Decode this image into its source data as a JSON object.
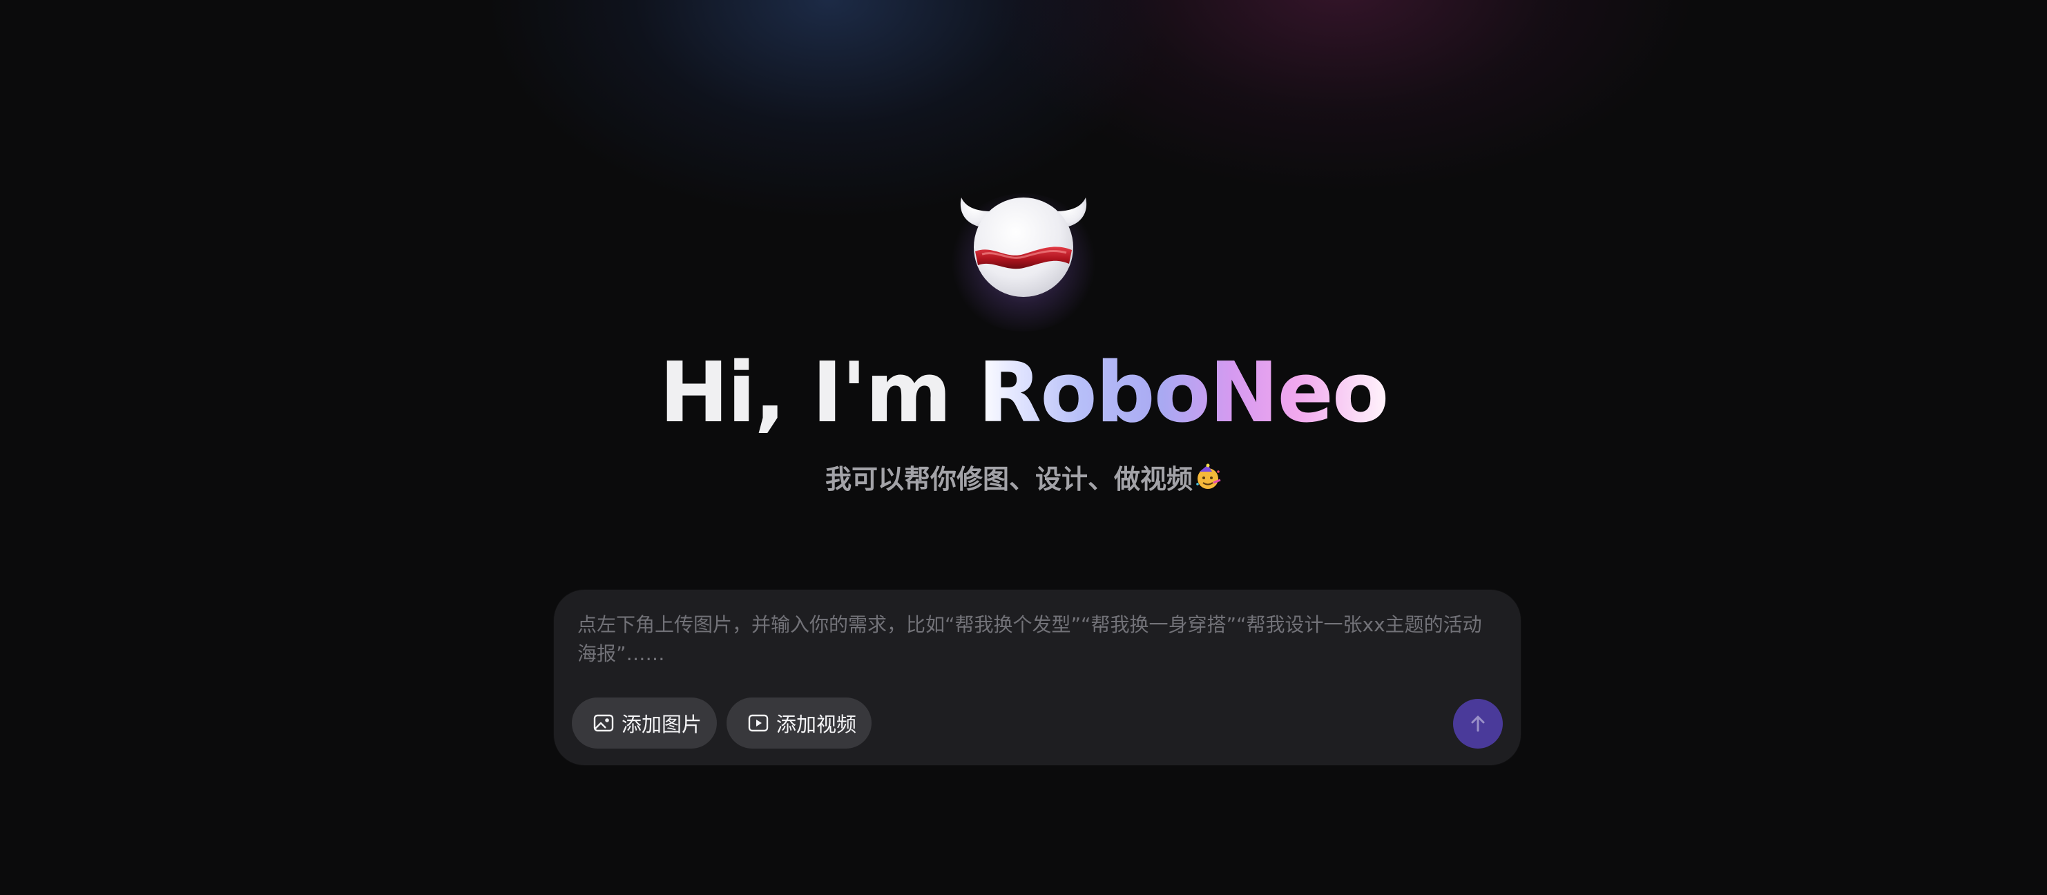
{
  "hero": {
    "greeting": "Hi, I'm ",
    "brand": "RoboNeo",
    "subtitle": "我可以帮你修图、设计、做视频",
    "subtitle_emoji": "🥳"
  },
  "composer": {
    "placeholder": "点左下角上传图片，并输入你的需求，比如“帮我换个发型”“帮我换一身穿搭”“帮我设计一张xx主题的活动海报”……",
    "value": "",
    "add_image_label": "添加图片",
    "add_image_icon": "image-icon",
    "add_video_label": "添加视频",
    "add_video_icon": "video-icon",
    "send_icon": "arrow-up-icon"
  },
  "colors": {
    "background": "#0b0b0c",
    "composer_bg": "#1e1e21",
    "pill_bg": "#38383c",
    "send_button": "#4a3a9a",
    "brand_gradient": [
      "#ffffff",
      "#a9a9f2",
      "#f1a8ee"
    ]
  }
}
